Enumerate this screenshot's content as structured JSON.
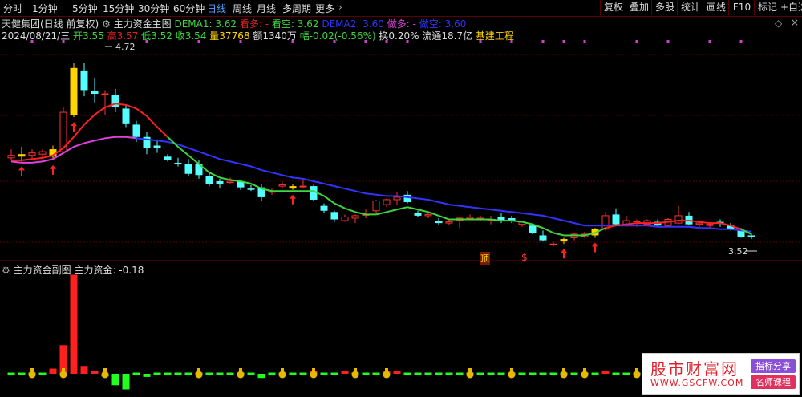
{
  "toolbar": {
    "tabs": [
      "分时",
      "1分钟",
      "5分钟",
      "15分钟",
      "30分钟",
      "60分钟",
      "日线",
      "周线",
      "月线",
      "多周期",
      "更多"
    ],
    "right_buttons": [
      "复权",
      "叠加",
      "多股",
      "统计",
      "画线",
      "F10",
      "标记",
      "+自选"
    ]
  },
  "main": {
    "title": "天健集团(日线 前复权)",
    "indicator_name": "主力资金主图",
    "dema1_label": "DEMA1: 3.62",
    "kanduo_label": "看多: -",
    "kankong_label": "看空: 3.62",
    "dema2_label": "DEMA2: 3.60",
    "zuoduo_label": "做多: -",
    "zuokong_label": "做空: 3.60",
    "date": "2024/08/21/三",
    "open": "开3.55",
    "high": "高3.57",
    "low": "低3.52",
    "close": "收3.54",
    "volume": "量37768",
    "amount": "额1340万",
    "change": "幅-0.02(-0.56%)",
    "turnover": "换0.20%",
    "float_cap": "流通18.7亿",
    "sector": "基建工程",
    "price_high_label": "4.72",
    "price_low_label": "3.52",
    "markers": [
      "顶",
      "$"
    ]
  },
  "sub": {
    "indicator_name": "主力资金副图",
    "value_label": "主力资金: -0.18"
  },
  "chart_data": {
    "type": "candlestick",
    "candles": [
      [
        3.95,
        4.02,
        3.93,
        3.97
      ],
      [
        3.96,
        4.04,
        3.92,
        3.98
      ],
      [
        3.97,
        4.02,
        3.94,
        3.99
      ],
      [
        3.98,
        4.02,
        3.95,
        4.0
      ],
      [
        3.96,
        4.05,
        3.93,
        4.02
      ],
      [
        4.0,
        4.36,
        3.98,
        4.32
      ],
      [
        4.3,
        4.72,
        4.28,
        4.68
      ],
      [
        4.66,
        4.72,
        4.45,
        4.5
      ],
      [
        4.49,
        4.6,
        4.4,
        4.47
      ],
      [
        4.47,
        4.5,
        4.3,
        4.47
      ],
      [
        4.46,
        4.51,
        4.32,
        4.36
      ],
      [
        4.35,
        4.38,
        4.2,
        4.23
      ],
      [
        4.22,
        4.25,
        4.08,
        4.12
      ],
      [
        4.12,
        4.16,
        3.98,
        4.03
      ],
      [
        4.05,
        4.1,
        3.99,
        4.03
      ],
      [
        3.96,
        3.98,
        3.92,
        3.93
      ],
      [
        3.91,
        3.95,
        3.88,
        3.9
      ],
      [
        3.9,
        3.94,
        3.8,
        3.82
      ],
      [
        3.9,
        3.93,
        3.78,
        3.81
      ],
      [
        3.8,
        3.83,
        3.72,
        3.74
      ],
      [
        3.76,
        3.78,
        3.7,
        3.74
      ],
      [
        3.75,
        3.79,
        3.74,
        3.76
      ],
      [
        3.76,
        3.77,
        3.69,
        3.71
      ],
      [
        3.7,
        3.73,
        3.68,
        3.69
      ],
      [
        3.71,
        3.74,
        3.6,
        3.63
      ],
      [
        3.67,
        3.7,
        3.65,
        3.68
      ],
      [
        3.72,
        3.75,
        3.7,
        3.73
      ],
      [
        3.72,
        3.74,
        3.69,
        3.7
      ],
      [
        3.72,
        3.78,
        3.7,
        3.72
      ],
      [
        3.72,
        3.73,
        3.6,
        3.61
      ],
      [
        3.56,
        3.58,
        3.5,
        3.52
      ],
      [
        3.51,
        3.52,
        3.43,
        3.45
      ],
      [
        3.44,
        3.49,
        3.43,
        3.47
      ],
      [
        3.46,
        3.49,
        3.42,
        3.48
      ],
      [
        3.49,
        3.53,
        3.46,
        3.49
      ],
      [
        3.52,
        3.61,
        3.5,
        3.6
      ],
      [
        3.57,
        3.62,
        3.55,
        3.61
      ],
      [
        3.61,
        3.67,
        3.57,
        3.63
      ],
      [
        3.65,
        3.68,
        3.58,
        3.59
      ],
      [
        3.5,
        3.52,
        3.47,
        3.48
      ],
      [
        3.48,
        3.51,
        3.46,
        3.49
      ],
      [
        3.44,
        3.46,
        3.4,
        3.42
      ],
      [
        3.42,
        3.45,
        3.4,
        3.43
      ],
      [
        3.44,
        3.47,
        3.38,
        3.46
      ],
      [
        3.46,
        3.49,
        3.45,
        3.47
      ],
      [
        3.45,
        3.48,
        3.44,
        3.46
      ],
      [
        3.44,
        3.48,
        3.41,
        3.45
      ],
      [
        3.47,
        3.5,
        3.42,
        3.44
      ],
      [
        3.46,
        3.48,
        3.42,
        3.44
      ],
      [
        3.41,
        3.44,
        3.39,
        3.43
      ],
      [
        3.4,
        3.41,
        3.33,
        3.34
      ],
      [
        3.32,
        3.36,
        3.27,
        3.28
      ],
      [
        3.25,
        3.27,
        3.23,
        3.25
      ],
      [
        3.27,
        3.3,
        3.25,
        3.29
      ],
      [
        3.3,
        3.34,
        3.28,
        3.33
      ],
      [
        3.31,
        3.35,
        3.3,
        3.33
      ],
      [
        3.32,
        3.38,
        3.3,
        3.37
      ],
      [
        3.37,
        3.51,
        3.36,
        3.48
      ],
      [
        3.49,
        3.54,
        3.4,
        3.41
      ],
      [
        3.41,
        3.48,
        3.39,
        3.44
      ],
      [
        3.42,
        3.45,
        3.39,
        3.43
      ],
      [
        3.41,
        3.45,
        3.4,
        3.44
      ],
      [
        3.43,
        3.45,
        3.39,
        3.4
      ],
      [
        3.4,
        3.46,
        3.39,
        3.45
      ],
      [
        3.42,
        3.56,
        3.41,
        3.48
      ],
      [
        3.48,
        3.51,
        3.4,
        3.41
      ],
      [
        3.41,
        3.44,
        3.39,
        3.42
      ],
      [
        3.4,
        3.42,
        3.38,
        3.41
      ],
      [
        3.43,
        3.45,
        3.39,
        3.42
      ],
      [
        3.4,
        3.42,
        3.36,
        3.37
      ],
      [
        3.36,
        3.38,
        3.3,
        3.31
      ],
      [
        3.32,
        3.34,
        3.29,
        3.31
      ]
    ],
    "up_idx": [
      1,
      4,
      6,
      27,
      53,
      56
    ],
    "series": [
      {
        "values": [
          3.93,
          3.93,
          3.94,
          3.95,
          3.97,
          4.03,
          4.12,
          4.22,
          4.3,
          4.36,
          4.39,
          4.38,
          4.35,
          4.29,
          4.2,
          4.12,
          4.04,
          3.97,
          3.9,
          3.83,
          3.79,
          3.77,
          3.76,
          3.74,
          3.7,
          3.68,
          3.68,
          3.68,
          3.68,
          3.68,
          3.64,
          3.58,
          3.54,
          3.51,
          3.49,
          3.49,
          3.51,
          3.53,
          3.55,
          3.53,
          3.51,
          3.48,
          3.45,
          3.45,
          3.45,
          3.45,
          3.45,
          3.44,
          3.44,
          3.43,
          3.41,
          3.38,
          3.34,
          3.32,
          3.32,
          3.32,
          3.34,
          3.38,
          3.4,
          3.41,
          3.42,
          3.42,
          3.42,
          3.43,
          3.44,
          3.44,
          3.43,
          3.42,
          3.42,
          3.4,
          3.37,
          3.33
        ]
      },
      {
        "values": [
          3.92,
          3.91,
          3.91,
          3.92,
          3.94,
          3.99,
          4.04,
          4.07,
          4.09,
          4.11,
          4.12,
          4.12,
          4.11,
          4.1,
          4.09,
          4.08,
          4.06,
          4.03,
          4.0,
          3.97,
          3.94,
          3.92,
          3.9,
          3.88,
          3.85,
          3.83,
          3.81,
          3.79,
          3.78,
          3.76,
          3.74,
          3.72,
          3.7,
          3.68,
          3.66,
          3.65,
          3.64,
          3.64,
          3.63,
          3.62,
          3.61,
          3.59,
          3.57,
          3.56,
          3.55,
          3.54,
          3.53,
          3.52,
          3.51,
          3.5,
          3.49,
          3.48,
          3.46,
          3.44,
          3.42,
          3.4,
          3.4,
          3.4,
          3.4,
          3.4,
          3.4,
          3.4,
          3.39,
          3.39,
          3.39,
          3.39,
          3.38,
          3.38,
          3.37,
          3.37,
          3.36,
          3.35
        ]
      }
    ],
    "sub_values": [
      0.03,
      0.02,
      0.03,
      0.03,
      0.1,
      0.55,
      1.9,
      0.15,
      0.05,
      -0.05,
      -0.22,
      -0.3,
      -0.03,
      -0.06,
      0.02,
      0.02,
      0.02,
      0.02,
      0.02,
      0.02,
      0.02,
      0.02,
      0.02,
      0.02,
      -0.08,
      0.02,
      0.02,
      0.02,
      0.03,
      0.04,
      -0.02,
      0.02,
      0.04,
      0.02,
      0.03,
      0.02,
      0.05,
      0.06,
      -0.02,
      0.03,
      0.02,
      0.02,
      0.02,
      0.03,
      0.02,
      0.02,
      0.02,
      0.03,
      0.02,
      0.02,
      0.02,
      0.02,
      0.02,
      0.02,
      0.02,
      0.02,
      0.03,
      0.05,
      0.02,
      -0.02,
      0.02,
      0.02,
      0.02,
      0.02,
      0.02,
      0.02,
      0.02,
      0.02,
      0.02,
      0.02,
      0.02,
      0.02
    ],
    "ylim": [
      3.16,
      4.92
    ]
  },
  "watermark": {
    "title": "股市财富网",
    "url": "WWW.GSCFW.COM",
    "tag1": "指标分享",
    "tag2": "名师课程"
  }
}
